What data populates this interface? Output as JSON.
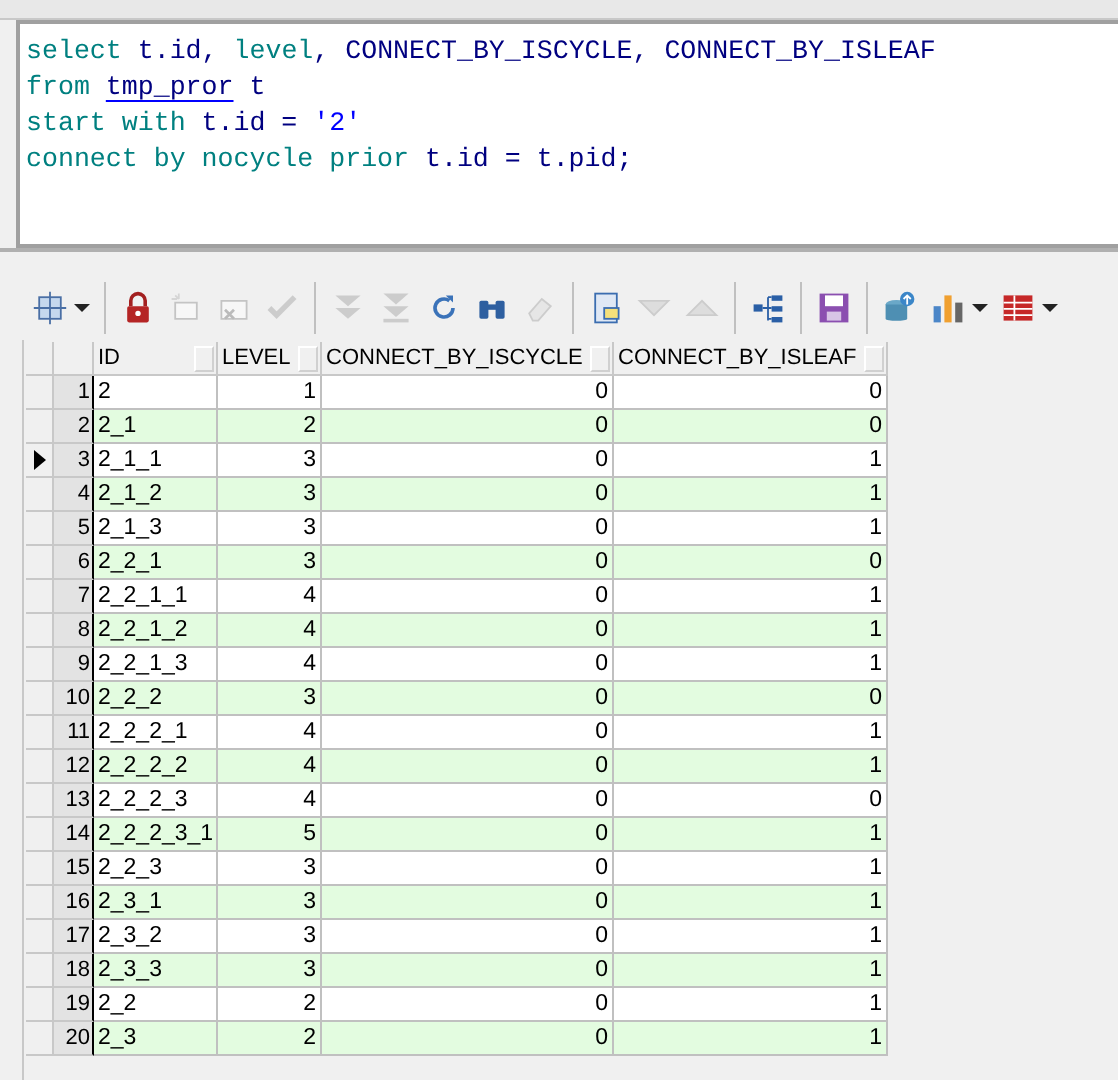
{
  "editor": {
    "lines": [
      [
        {
          "text": "select",
          "kind": "keyword"
        },
        {
          "text": " t.id, ",
          "kind": "ident"
        },
        {
          "text": "level",
          "kind": "keyword"
        },
        {
          "text": ", CONNECT_BY_ISCYCLE, CONNECT_BY_ISLEAF",
          "kind": "ident"
        }
      ],
      [
        {
          "text": "from ",
          "kind": "keyword"
        },
        {
          "text": "tmp_pror",
          "kind": "table"
        },
        {
          "text": " t",
          "kind": "ident"
        }
      ],
      [
        {
          "text": "start with",
          "kind": "keyword"
        },
        {
          "text": " t.id = ",
          "kind": "ident"
        },
        {
          "text": "'2'",
          "kind": "string"
        }
      ],
      [
        {
          "text": "connect by nocycle prior",
          "kind": "keyword"
        },
        {
          "text": " t.id = t.pid;",
          "kind": "ident"
        }
      ]
    ]
  },
  "toolbar": [
    {
      "kind": "select-grid",
      "disabled": false,
      "caret": true
    },
    {
      "kind": "sep"
    },
    {
      "kind": "lock",
      "disabled": false
    },
    {
      "kind": "new-record",
      "disabled": true
    },
    {
      "kind": "delete-record",
      "disabled": true
    },
    {
      "kind": "check",
      "disabled": true
    },
    {
      "kind": "sep"
    },
    {
      "kind": "fetch-next",
      "disabled": true
    },
    {
      "kind": "fetch-last",
      "disabled": true
    },
    {
      "kind": "refresh",
      "disabled": false
    },
    {
      "kind": "find",
      "disabled": false
    },
    {
      "kind": "clear",
      "disabled": true
    },
    {
      "kind": "sep"
    },
    {
      "kind": "form",
      "disabled": false
    },
    {
      "kind": "down",
      "disabled": true
    },
    {
      "kind": "up",
      "disabled": true
    },
    {
      "kind": "sep"
    },
    {
      "kind": "tree",
      "disabled": false
    },
    {
      "kind": "sep"
    },
    {
      "kind": "save",
      "disabled": false
    },
    {
      "kind": "sep"
    },
    {
      "kind": "export",
      "disabled": false
    },
    {
      "kind": "chart",
      "disabled": false,
      "caret": true
    },
    {
      "kind": "table",
      "disabled": false,
      "caret": true
    }
  ],
  "grid": {
    "columns": [
      "ID",
      "LEVEL",
      "CONNECT_BY_ISCYCLE",
      "CONNECT_BY_ISLEAF"
    ],
    "rows": [
      {
        "num": "1",
        "cells": [
          "2",
          "1",
          "0",
          "0"
        ],
        "selected": false
      },
      {
        "num": "2",
        "cells": [
          "2_1",
          "2",
          "0",
          "0"
        ],
        "selected": false
      },
      {
        "num": "3",
        "cells": [
          "2_1_1",
          "3",
          "0",
          "1"
        ],
        "selected": true
      },
      {
        "num": "4",
        "cells": [
          "2_1_2",
          "3",
          "0",
          "1"
        ],
        "selected": false
      },
      {
        "num": "5",
        "cells": [
          "2_1_3",
          "3",
          "0",
          "1"
        ],
        "selected": false
      },
      {
        "num": "6",
        "cells": [
          "2_2_1",
          "3",
          "0",
          "0"
        ],
        "selected": false
      },
      {
        "num": "7",
        "cells": [
          "2_2_1_1",
          "4",
          "0",
          "1"
        ],
        "selected": false
      },
      {
        "num": "8",
        "cells": [
          "2_2_1_2",
          "4",
          "0",
          "1"
        ],
        "selected": false
      },
      {
        "num": "9",
        "cells": [
          "2_2_1_3",
          "4",
          "0",
          "1"
        ],
        "selected": false
      },
      {
        "num": "10",
        "cells": [
          "2_2_2",
          "3",
          "0",
          "0"
        ],
        "selected": false
      },
      {
        "num": "11",
        "cells": [
          "2_2_2_1",
          "4",
          "0",
          "1"
        ],
        "selected": false
      },
      {
        "num": "12",
        "cells": [
          "2_2_2_2",
          "4",
          "0",
          "1"
        ],
        "selected": false
      },
      {
        "num": "13",
        "cells": [
          "2_2_2_3",
          "4",
          "0",
          "0"
        ],
        "selected": false
      },
      {
        "num": "14",
        "cells": [
          "2_2_2_3_1",
          "5",
          "0",
          "1"
        ],
        "selected": false
      },
      {
        "num": "15",
        "cells": [
          "2_2_3",
          "3",
          "0",
          "1"
        ],
        "selected": false
      },
      {
        "num": "16",
        "cells": [
          "2_3_1",
          "3",
          "0",
          "1"
        ],
        "selected": false
      },
      {
        "num": "17",
        "cells": [
          "2_3_2",
          "3",
          "0",
          "1"
        ],
        "selected": false
      },
      {
        "num": "18",
        "cells": [
          "2_3_3",
          "3",
          "0",
          "1"
        ],
        "selected": false
      },
      {
        "num": "19",
        "cells": [
          "2_2",
          "2",
          "0",
          "1"
        ],
        "selected": false
      },
      {
        "num": "20",
        "cells": [
          "2_3",
          "2",
          "0",
          "1"
        ],
        "selected": false
      }
    ]
  }
}
